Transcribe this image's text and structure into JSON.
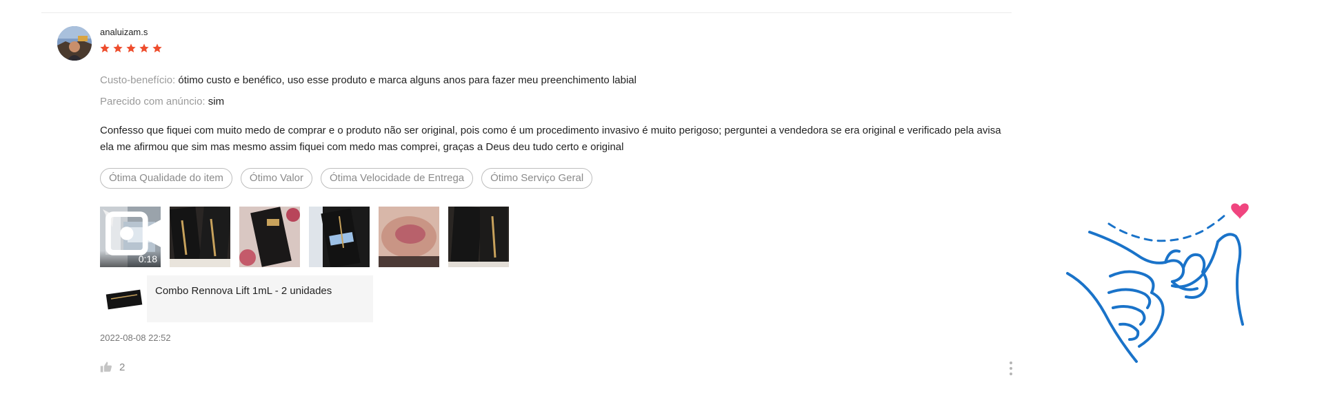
{
  "review": {
    "username": "analuizam.s",
    "rating": 5,
    "value_label": "Custo-benefício:",
    "value_text": "ótimo custo e benéfico, uso esse produto e marca alguns anos para fazer meu preenchimento labial",
    "similar_label": "Parecido com anúncio:",
    "similar_text": "sim",
    "text": "Confesso que fiquei com muito medo de comprar e o produto não ser original, pois como é um procedimento invasivo é muito perigoso; perguntei a vendedora se era original e verificado pela avisa ela me afirmou que sim mas mesmo assim fiquei com medo mas comprei, graças a Deus deu tudo certo e original",
    "tags": [
      "Ótima Qualidade do item",
      "Ótimo Valor",
      "Ótima Velocidade de Entrega",
      "Ótimo Serviço Geral"
    ],
    "video_duration": "0:18",
    "product_name": "Combo Rennova Lift 1mL - 2 unidades",
    "date": "2022-08-08 22:52",
    "likes": "2"
  },
  "colors": {
    "star": "#ee4d2d",
    "illustration": "#1a73c9",
    "heart": "#f0457f"
  },
  "icons": [
    "star-icon",
    "video-camera-icon",
    "thumbs-up-icon",
    "more-options-icon",
    "pinky-promise-illustration"
  ]
}
